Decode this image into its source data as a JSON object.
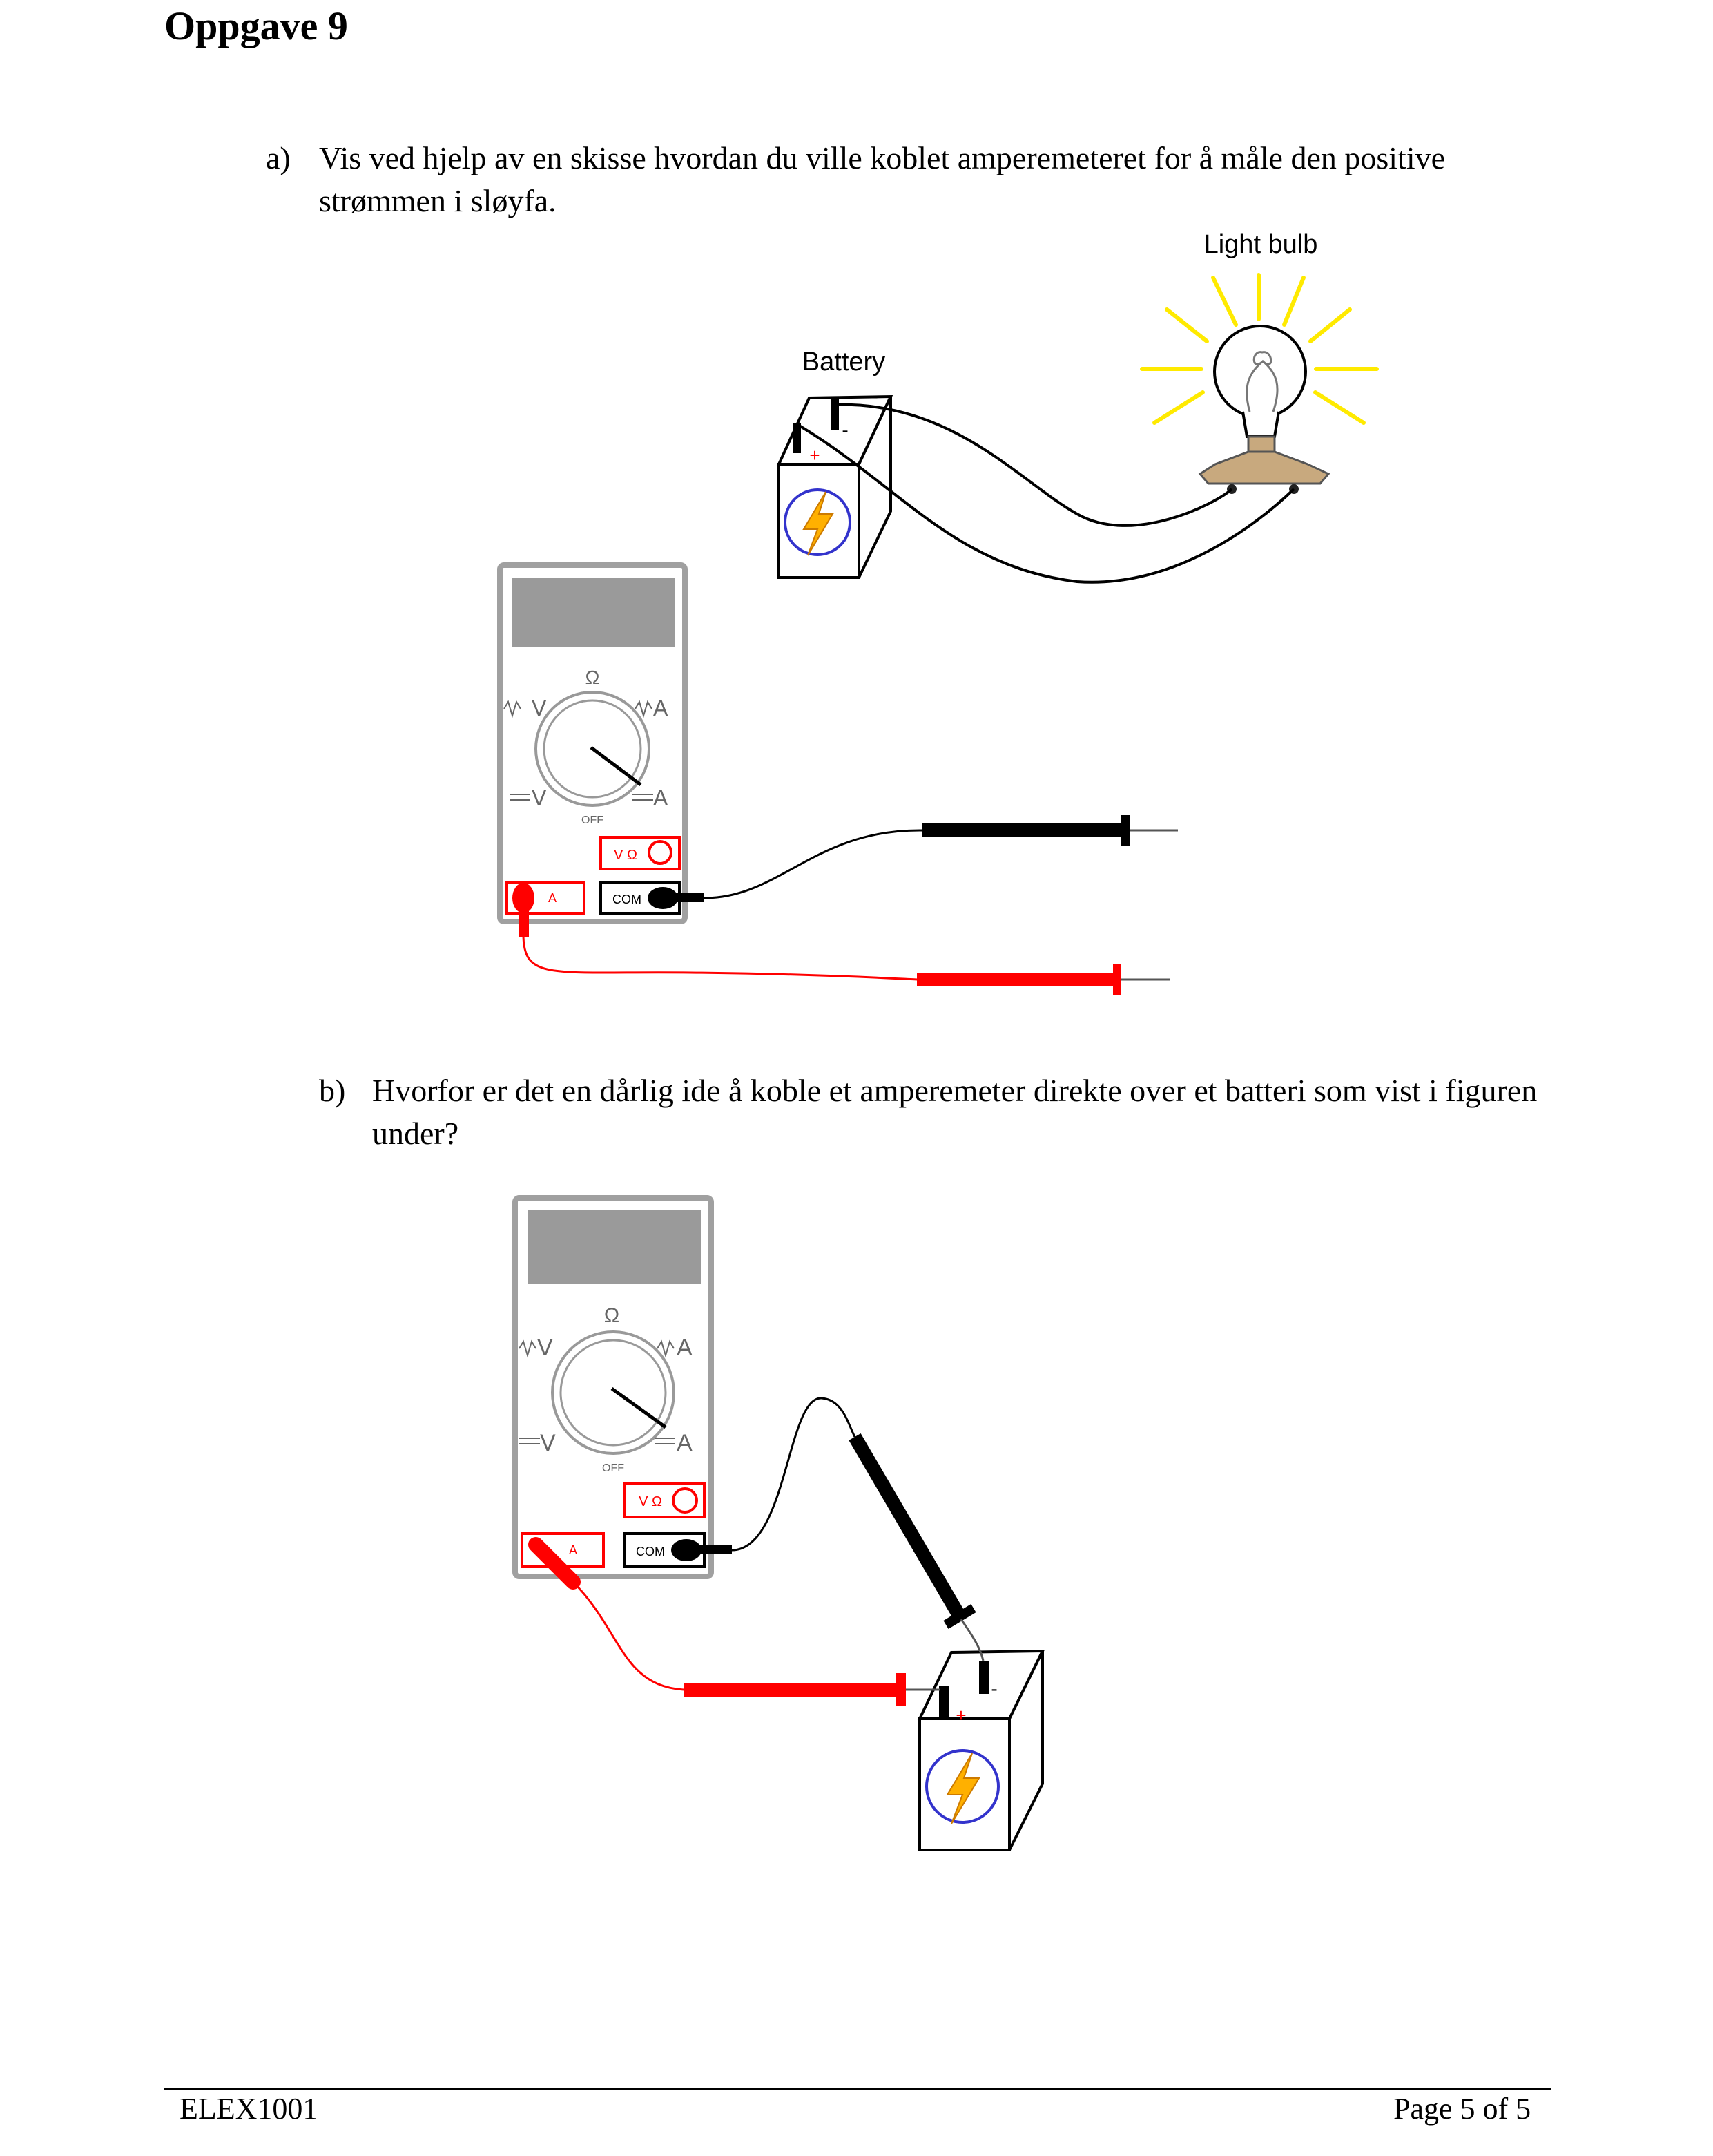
{
  "title": "Oppgave 9",
  "questions": [
    {
      "label": "a)",
      "text": "Vis ved hjelp av en skisse hvordan du ville koblet amperemeteret for å måle den positive strømmen i sløyfa."
    },
    {
      "label": "b)",
      "text": "Hvorfor er det en dårlig ide å koble et amperemeter direkte over et batteri som vist i figuren under?"
    }
  ],
  "figure_a": {
    "battery_label": "Battery",
    "bulb_label": "Light bulb",
    "meter": {
      "omega": "Ω",
      "ac_v": "V",
      "ac_a": "A",
      "dc_v": "V",
      "dc_a": "A",
      "off": "OFF",
      "jack_a": "A",
      "jack_com": "COM",
      "jack_v_ohm": "V Ω"
    },
    "battery_plus": "+",
    "battery_minus": "-"
  },
  "figure_b": {
    "meter": {
      "omega": "Ω",
      "ac_v": "V",
      "ac_a": "A",
      "dc_v": "V",
      "dc_a": "A",
      "off": "OFF",
      "jack_a": "A",
      "jack_com": "COM",
      "jack_v_ohm": "V Ω"
    },
    "battery_plus": "+",
    "battery_minus": "-"
  },
  "colors": {
    "lead_red": "#ff0000",
    "lead_black": "#000000",
    "bulb_rays": "#ffea00",
    "bolt": "#ffb000",
    "ring": "#3333cc",
    "display": "#9a9a9a",
    "bulb_base": "#c8a97e"
  },
  "footer": {
    "left": "ELEX1001",
    "right": "Page 5 of 5"
  }
}
